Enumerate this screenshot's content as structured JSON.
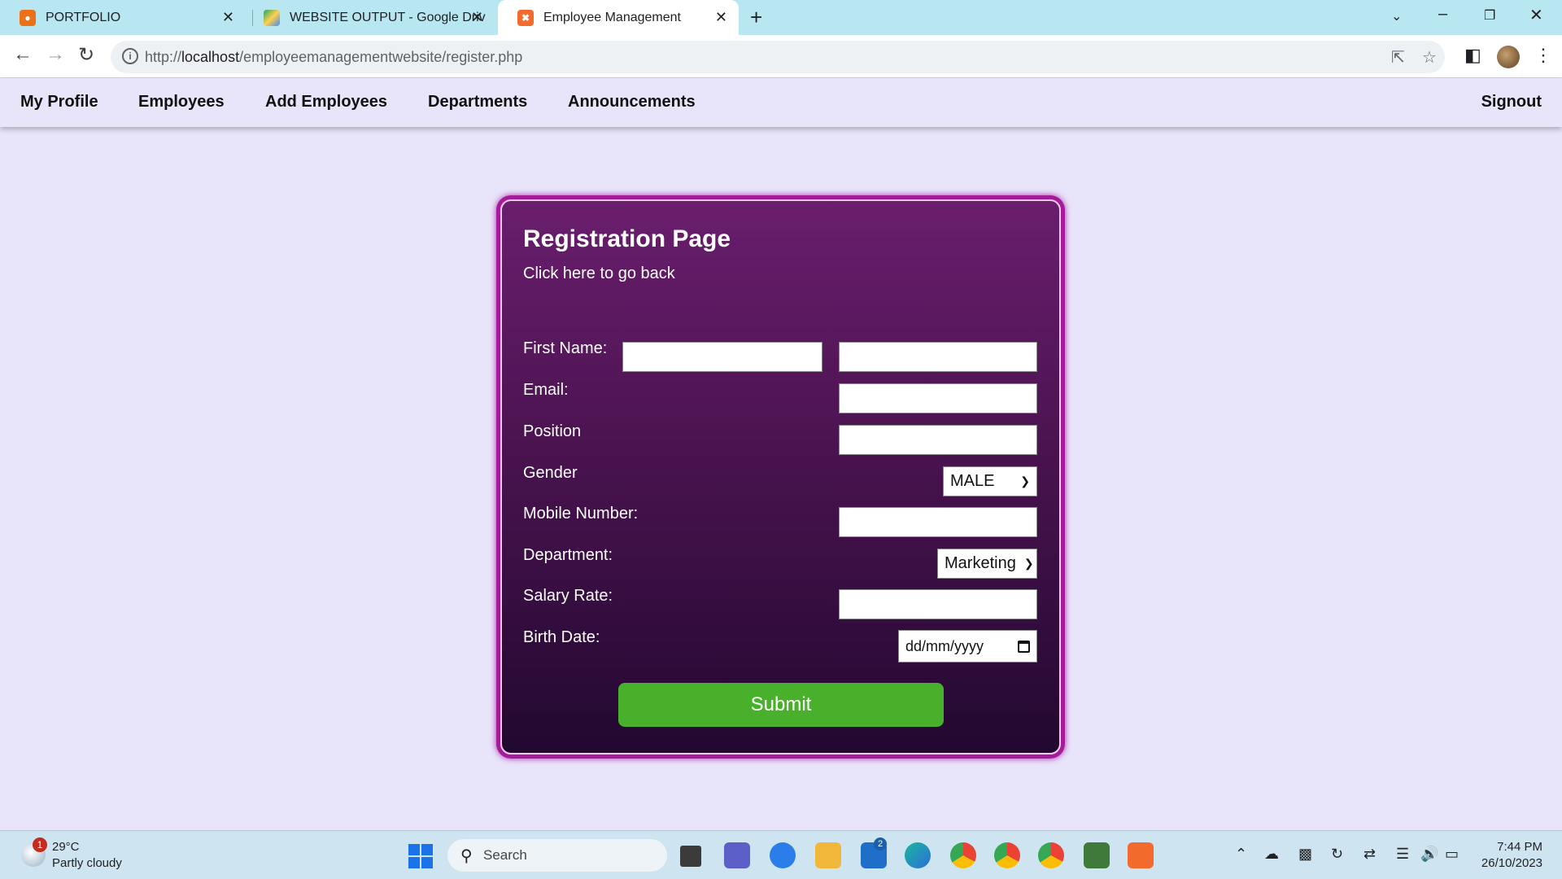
{
  "browser": {
    "tabs": [
      {
        "title": "PORTFOLIO",
        "active": false
      },
      {
        "title": "WEBSITE OUTPUT - Google Driv",
        "active": false
      },
      {
        "title": "Employee Management",
        "active": true
      }
    ],
    "address": {
      "host_prefix": "http://",
      "host": "localhost",
      "path": "/employeemanagementwebsite/register.php"
    }
  },
  "nav": {
    "items": [
      "My Profile",
      "Employees",
      "Add Employees",
      "Departments",
      "Announcements"
    ],
    "signout": "Signout"
  },
  "form": {
    "title": "Registration Page",
    "back_link": "Click here to go back",
    "labels": {
      "first_name": "First Name:",
      "email": "Email:",
      "position": "Position",
      "gender": "Gender",
      "mobile": "Mobile Number:",
      "department": "Department:",
      "salary": "Salary Rate:",
      "birth_date": "Birth Date:"
    },
    "values": {
      "first_name": "",
      "last_name": "",
      "email": "",
      "position": "",
      "gender": "MALE",
      "mobile": "",
      "department": "Marketing",
      "salary": "",
      "birth_date_placeholder": "dd/mm/yyyy"
    },
    "submit": "Submit"
  },
  "taskbar": {
    "weather": {
      "temp": "29°C",
      "desc": "Partly cloudy",
      "badge": "1"
    },
    "search_label": "Search",
    "mail_badge": "2",
    "clock": {
      "time": "7:44 PM",
      "date": "26/10/2023"
    }
  },
  "colors": {
    "card_border": "#a51c9a",
    "card_top": "#6a1e6d",
    "card_bottom": "#220830",
    "submit": "#48b02a",
    "page_bg": "#e8e4fa"
  }
}
